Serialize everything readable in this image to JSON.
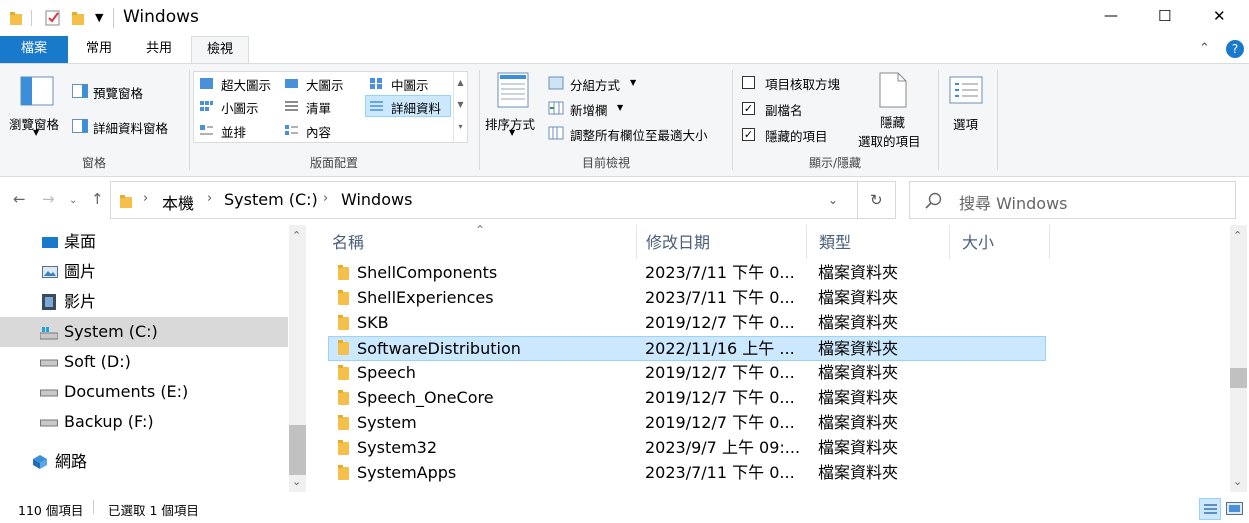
{
  "window": {
    "title": "Windows",
    "minimize_glyph": "—",
    "maximize_glyph": "☐",
    "close_glyph": "✕"
  },
  "tabs": [
    {
      "label": "檔案"
    },
    {
      "label": "常用"
    },
    {
      "label": "共用"
    },
    {
      "label": "檢視"
    }
  ],
  "ribbon": {
    "panes": {
      "nav_pane": "瀏覽窗格",
      "preview_pane": "預覽窗格",
      "details_pane": "詳細資料窗格",
      "group": "窗格"
    },
    "layout": {
      "extra_large": "超大圖示",
      "large": "大圖示",
      "medium": "中圖示",
      "small": "小圖示",
      "list": "清單",
      "details": "詳細資料",
      "tiles": "並排",
      "content": "內容",
      "group": "版面配置"
    },
    "current_view": {
      "sort_by": "排序方式",
      "group_by": "分組方式",
      "add_columns": "新增欄",
      "size_all_columns": "調整所有欄位至最適大小",
      "group": "目前檢視"
    },
    "show_hide": {
      "item_checkboxes": "項目核取方塊",
      "file_extensions": "副檔名",
      "hidden_items": "隱藏的項目",
      "hide_selected_line1": "隱藏",
      "hide_selected_line2": "選取的項目",
      "group": "顯示/隱藏",
      "item_checkboxes_checked": false,
      "file_extensions_checked": true,
      "hidden_items_checked": true
    },
    "options": "選項"
  },
  "address": {
    "crumbs": [
      "本機",
      "System (C:)",
      "Windows"
    ],
    "search_placeholder": "搜尋 Windows"
  },
  "navpane": [
    {
      "label": "桌面",
      "icon": "desktop-icon"
    },
    {
      "label": "圖片",
      "icon": "pictures-icon"
    },
    {
      "label": "影片",
      "icon": "videos-icon"
    },
    {
      "label": "System (C:)",
      "icon": "system-drive-icon",
      "selected": true
    },
    {
      "label": "Soft (D:)",
      "icon": "drive-icon"
    },
    {
      "label": "Documents (E:)",
      "icon": "drive-icon"
    },
    {
      "label": "Backup (F:)",
      "icon": "drive-icon"
    },
    {
      "label": "網路",
      "icon": "network-icon"
    }
  ],
  "columns": {
    "name": "名稱",
    "modified": "修改日期",
    "type": "類型",
    "size": "大小"
  },
  "files": [
    {
      "name": "ShellComponents",
      "date": "2023/7/11 下午 0...",
      "type": "檔案資料夾"
    },
    {
      "name": "ShellExperiences",
      "date": "2023/7/11 下午 0...",
      "type": "檔案資料夾"
    },
    {
      "name": "SKB",
      "date": "2019/12/7 下午 0...",
      "type": "檔案資料夾"
    },
    {
      "name": "SoftwareDistribution",
      "date": "2022/11/16 上午 ...",
      "type": "檔案資料夾",
      "selected": true
    },
    {
      "name": "Speech",
      "date": "2019/12/7 下午 0...",
      "type": "檔案資料夾"
    },
    {
      "name": "Speech_OneCore",
      "date": "2019/12/7 下午 0...",
      "type": "檔案資料夾"
    },
    {
      "name": "System",
      "date": "2019/12/7 下午 0...",
      "type": "檔案資料夾"
    },
    {
      "name": "System32",
      "date": "2023/9/7 上午 09:...",
      "type": "檔案資料夾"
    },
    {
      "name": "SystemApps",
      "date": "2023/7/11 下午 0...",
      "type": "檔案資料夾"
    }
  ],
  "status": {
    "item_count": "110 個項目",
    "selected": "已選取 1 個項目"
  },
  "colors": {
    "accent": "#1979ca",
    "selection": "#cce8ff",
    "selection_border": "#99d1ff",
    "header_text": "#4c607a"
  }
}
